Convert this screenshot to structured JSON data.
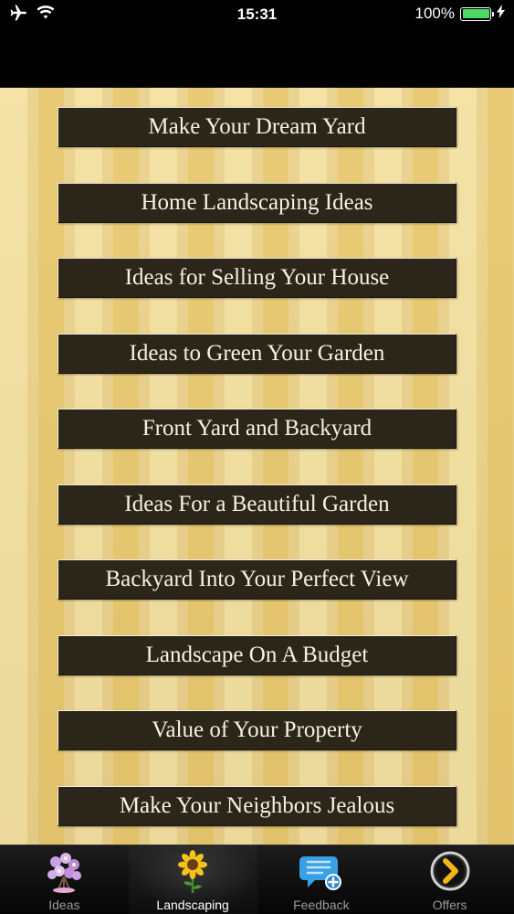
{
  "status": {
    "time": "15:31",
    "battery": "100%"
  },
  "menu": {
    "items": [
      {
        "label": "Make Your Dream Yard"
      },
      {
        "label": "Home Landscaping Ideas"
      },
      {
        "label": "Ideas for Selling Your House"
      },
      {
        "label": "Ideas to Green Your Garden"
      },
      {
        "label": "Front Yard and Backyard"
      },
      {
        "label": "Ideas For a Beautiful Garden"
      },
      {
        "label": "Backyard Into Your Perfect View"
      },
      {
        "label": "Landscape On A Budget"
      },
      {
        "label": "Value of Your Property"
      },
      {
        "label": "Make Your Neighbors Jealous"
      }
    ]
  },
  "tabs": [
    {
      "label": "Ideas",
      "icon": "flowers-icon",
      "active": false
    },
    {
      "label": "Landscaping",
      "icon": "sunflower-icon",
      "active": true
    },
    {
      "label": "Feedback",
      "icon": "speech-bubble-plus-icon",
      "active": false
    },
    {
      "label": "Offers",
      "icon": "chevron-circle-icon",
      "active": false
    }
  ],
  "colors": {
    "button_bg": "#2b2619",
    "button_text": "#f6f1e4",
    "stripe_light": "#f3e0a0",
    "stripe_dark": "#e8c86e",
    "battery_green": "#4cd964"
  }
}
